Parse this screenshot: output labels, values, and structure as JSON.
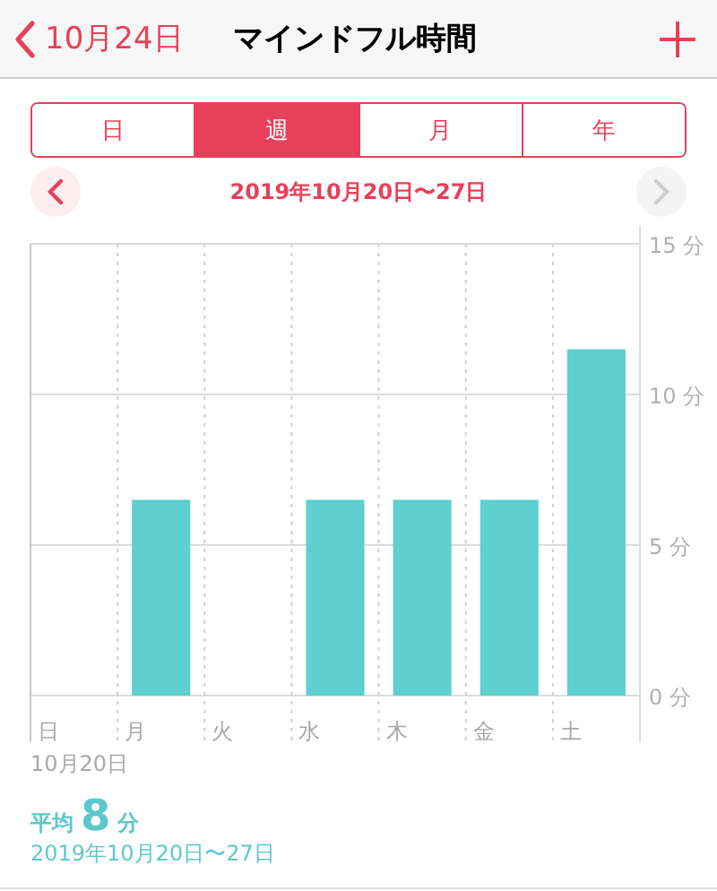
{
  "nav": {
    "back_label": "10月24日",
    "title": "マインドフル時間"
  },
  "segments": [
    {
      "label": "日",
      "selected": false
    },
    {
      "label": "週",
      "selected": true
    },
    {
      "label": "月",
      "selected": false
    },
    {
      "label": "年",
      "selected": false
    }
  ],
  "range": {
    "label": "2019年10月20日〜27日",
    "next_disabled": true
  },
  "chart": {
    "chart_data": {
      "type": "bar",
      "categories": [
        "日",
        "月",
        "火",
        "水",
        "木",
        "金",
        "土"
      ],
      "series": [
        {
          "color": "#5fcfcf",
          "values": [
            null,
            6.5,
            null,
            6.5,
            6.5,
            6.5,
            11.5
          ]
        }
      ],
      "ylim": [
        0,
        15
      ],
      "yticks": [
        {
          "value": 0,
          "label": "0 分"
        },
        {
          "value": 5,
          "label": "5 分"
        },
        {
          "value": 10,
          "label": "10 分"
        },
        {
          "value": 15,
          "label": "15 分"
        }
      ]
    },
    "start_date": "10月20日"
  },
  "summary": {
    "label": "平均",
    "value": "8",
    "unit": "分",
    "range": "2019年10月20日〜27日"
  }
}
